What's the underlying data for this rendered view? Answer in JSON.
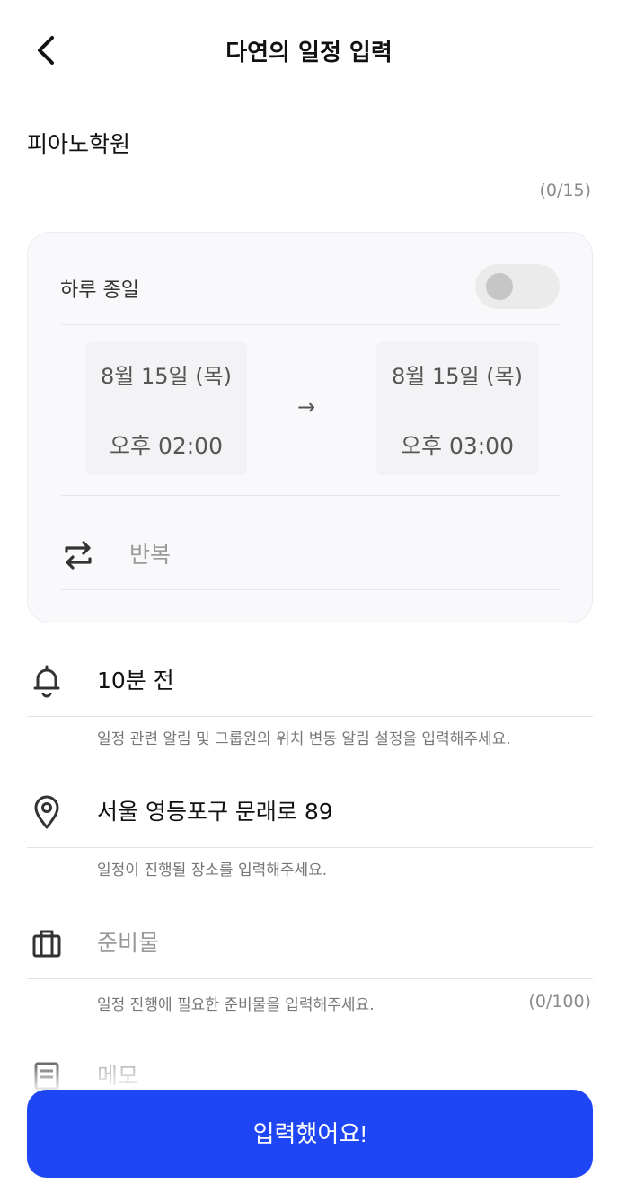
{
  "header": {
    "title": "다연의 일정 입력",
    "back_icon": "chevron-left-icon"
  },
  "title_field": {
    "value": "피아노학원",
    "count": "(0/15)"
  },
  "schedule_card": {
    "all_day": {
      "label": "하루 종일",
      "enabled": false
    },
    "start": {
      "date": "8월 15일 (목)",
      "time": "오후 02:00"
    },
    "arrow": "→",
    "end": {
      "date": "8월 15일 (목)",
      "time": "오후 03:00"
    },
    "repeat": {
      "label": "반복",
      "icon": "repeat-icon"
    }
  },
  "alarm": {
    "value": "10분 전",
    "icon": "bell-icon",
    "helper": "일정 관련 알림 및 그룹원의 위치 변동 알림 설정을 입력해주세요."
  },
  "location": {
    "value": "서울 영등포구 문래로 89",
    "icon": "location-pin-icon",
    "helper": "일정이 진행될 장소를 입력해주세요."
  },
  "supplies": {
    "placeholder": "준비물",
    "icon": "briefcase-icon",
    "helper": "일정 진행에 필요한 준비물을 입력해주세요.",
    "count": "(0/100)"
  },
  "memo": {
    "placeholder": "메모",
    "icon": "memo-icon"
  },
  "submit": {
    "label": "입력했어요!"
  },
  "colors": {
    "primary": "#1e46f5",
    "card_bg": "#f9f9fc",
    "toggle_off": "#ebebeb"
  }
}
